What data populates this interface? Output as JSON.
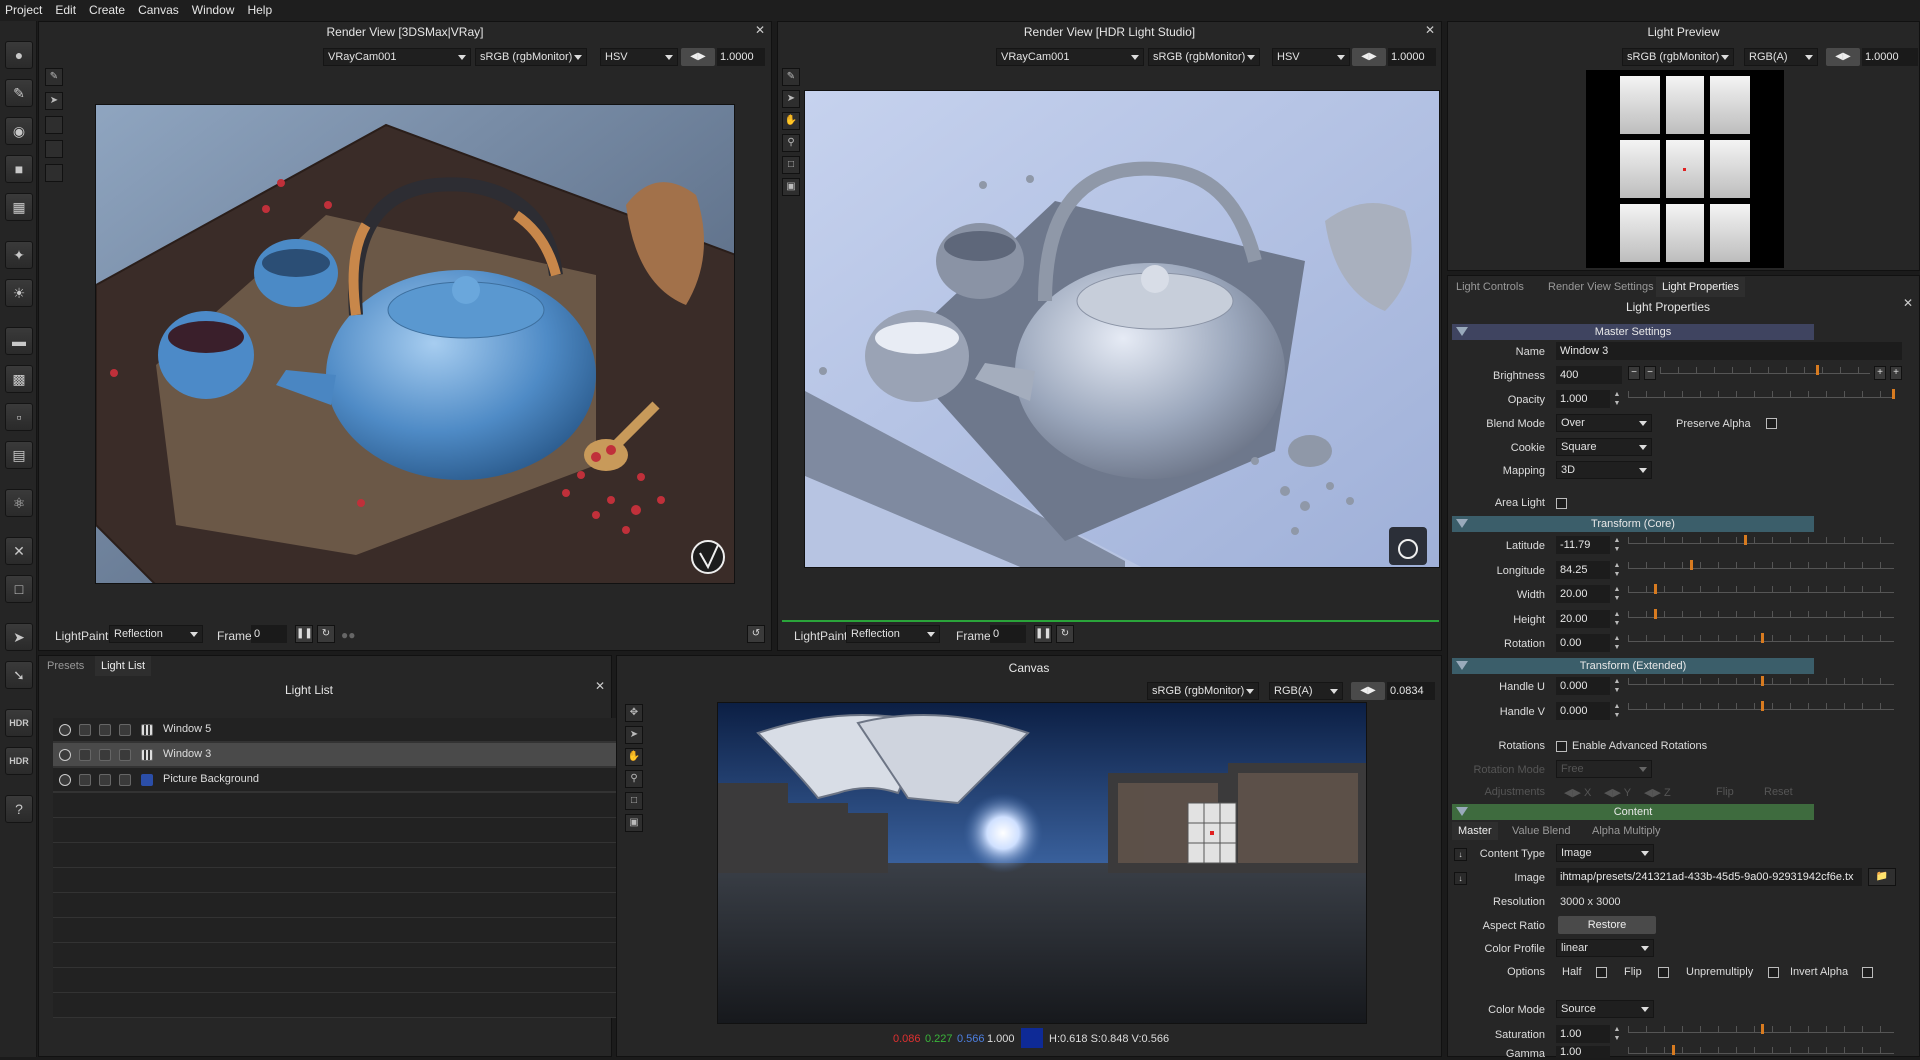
{
  "menubar": [
    "Project",
    "Edit",
    "Create",
    "Canvas",
    "Window",
    "Help"
  ],
  "toolbar": {
    "hdr1": "HDR",
    "hdr2": "HDR",
    "help": "?"
  },
  "vray_view": {
    "title": "Render View [3DSMax|VRay]",
    "camera": "VRayCam001",
    "colorspace": "sRGB (rgbMonitor)",
    "mode": "HSV",
    "exposure": "1.0000",
    "lightpaint_label": "LightPaint",
    "lightpaint_mode": "Reflection",
    "frame_label": "Frame",
    "frame_value": "0"
  },
  "hdr_view": {
    "title": "Render View [HDR Light Studio]",
    "camera": "VRayCam001",
    "colorspace": "sRGB (rgbMonitor)",
    "mode": "HSV",
    "exposure": "1.0000",
    "lightpaint_label": "LightPaint",
    "lightpaint_mode": "Reflection",
    "frame_label": "Frame",
    "frame_value": "0"
  },
  "light_preview": {
    "title": "Light Preview",
    "colorspace": "sRGB (rgbMonitor)",
    "channel": "RGB(A)",
    "exposure": "1.0000"
  },
  "light_list_panel": {
    "tabs": [
      "Presets",
      "Light List"
    ],
    "active_tab": "Light List",
    "title": "Light List",
    "items": [
      {
        "name": "Window 5",
        "selected": false
      },
      {
        "name": "Window 3",
        "selected": true
      },
      {
        "name": "Picture Background",
        "selected": false
      }
    ]
  },
  "canvas": {
    "title": "Canvas",
    "colorspace": "sRGB (rgbMonitor)",
    "channel": "RGB(A)",
    "exposure": "0.0834",
    "readout": {
      "r": "0.086",
      "g": "0.227",
      "b": "0.566",
      "a": "1.000",
      "hsv": "H:0.618 S:0.848 V:0.566"
    },
    "swatch_color": "#0e2a96"
  },
  "props": {
    "tabs": [
      "Light Controls",
      "Render View Settings",
      "Light Properties"
    ],
    "active_tab": "Light Properties",
    "title": "Light Properties",
    "master": {
      "header": "Master Settings",
      "name_label": "Name",
      "name": "Window 3",
      "brightness_label": "Brightness",
      "brightness": "400",
      "opacity_label": "Opacity",
      "opacity": "1.000",
      "blend_label": "Blend Mode",
      "blend": "Over",
      "preserve_alpha_label": "Preserve Alpha",
      "cookie_label": "Cookie",
      "cookie": "Square",
      "mapping_label": "Mapping",
      "mapping": "3D",
      "area_light_label": "Area Light"
    },
    "transform_core": {
      "header": "Transform (Core)",
      "latitude_label": "Latitude",
      "latitude": "-11.79",
      "longitude_label": "Longitude",
      "longitude": "84.25",
      "width_label": "Width",
      "width": "20.00",
      "height_label": "Height",
      "height": "20.00",
      "rotation_label": "Rotation",
      "rotation": "0.00"
    },
    "transform_ext": {
      "header": "Transform (Extended)",
      "handle_u_label": "Handle U",
      "handle_u": "0.000",
      "handle_v_label": "Handle V",
      "handle_v": "0.000",
      "rotations_label": "Rotations",
      "enable_adv_label": "Enable Advanced Rotations",
      "rotation_mode_label": "Rotation Mode",
      "rotation_mode": "Free",
      "adjustments_label": "Adjustments",
      "x": "X",
      "y": "Y",
      "z": "Z",
      "flip": "Flip",
      "reset": "Reset"
    },
    "content": {
      "header": "Content",
      "subtabs": [
        "Master",
        "Value Blend",
        "Alpha Multiply"
      ],
      "content_type_label": "Content Type",
      "content_type": "Image",
      "image_label": "Image",
      "image": "ihtmap/presets/241321ad-433b-45d5-9a00-92931942cf6e.tx",
      "resolution_label": "Resolution",
      "resolution": "3000 x 3000",
      "aspect_label": "Aspect Ratio",
      "aspect_button": "Restore",
      "color_profile_label": "Color Profile",
      "color_profile": "linear",
      "options_label": "Options",
      "opt_half": "Half",
      "opt_flip": "Flip",
      "opt_unpremultiply": "Unpremultiply",
      "opt_invert_alpha": "Invert Alpha",
      "color_mode_label": "Color Mode",
      "color_mode": "Source",
      "saturation_label": "Saturation",
      "saturation": "1.00",
      "gamma_label": "Gamma",
      "gamma": "1.00"
    }
  }
}
